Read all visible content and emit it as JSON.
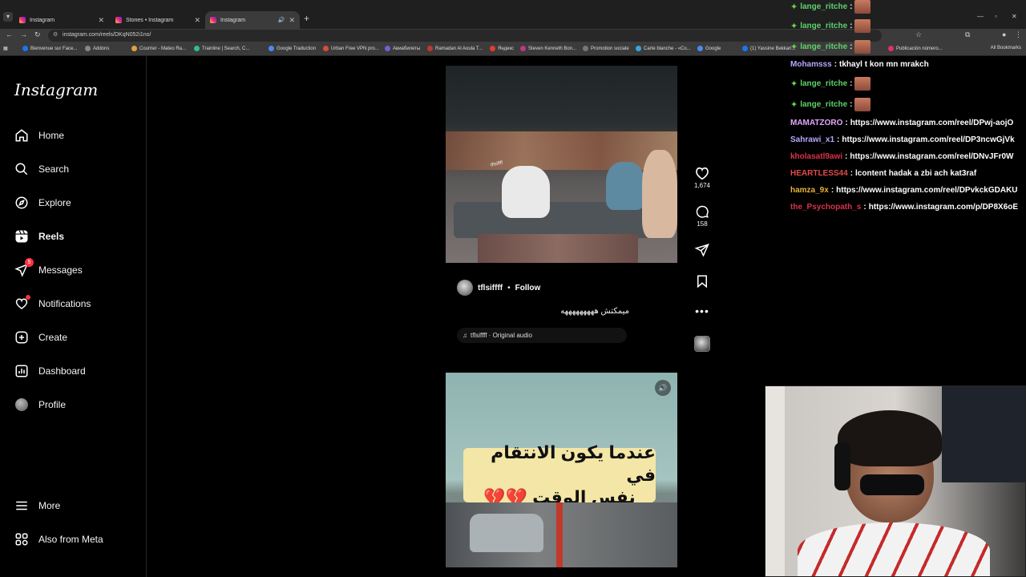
{
  "browser": {
    "tabs": [
      {
        "title": "Instagram",
        "active": false
      },
      {
        "title": "Stories • Instagram",
        "active": false
      },
      {
        "title": "Instagram",
        "active": true
      }
    ],
    "url": "instagram.com/reels/DKqN052i1no/",
    "bookmarks": [
      {
        "label": "Bienvenue sur Face...",
        "color": "#1877f2"
      },
      {
        "label": "Addons",
        "color": "#888888"
      },
      {
        "label": "Courrier - Mateo Ra...",
        "color": "#e0a33a"
      },
      {
        "label": "Trainline | Search, C...",
        "color": "#2ec08a"
      },
      {
        "label": "Google Traduction",
        "color": "#4a8af4"
      },
      {
        "label": "Urban Free VPN pro...",
        "color": "#d94b3a"
      },
      {
        "label": "Авиабилеты",
        "color": "#7a5cd6"
      },
      {
        "label": "Ramadan Al Aoula T...",
        "color": "#c0392b"
      },
      {
        "label": "Яндекс",
        "color": "#e63b2e"
      },
      {
        "label": "Steven Kenneth Bon...",
        "color": "#c13584"
      },
      {
        "label": "Promotion sociale",
        "color": "#777777"
      },
      {
        "label": "Carte blanche - «Co...",
        "color": "#3aa6d9"
      },
      {
        "label": "Google",
        "color": "#4a8af4"
      },
      {
        "label": "(1) Yassine Bekkari...",
        "color": "#1877f2"
      },
      {
        "label": "Publicación número...",
        "color": "#e1306c"
      }
    ],
    "all_bookmarks": "All Bookmarks"
  },
  "sidebar": {
    "logo": "Instagram",
    "items": [
      {
        "label": "Home",
        "icon": "home-icon"
      },
      {
        "label": "Search",
        "icon": "search-icon"
      },
      {
        "label": "Explore",
        "icon": "compass-icon"
      },
      {
        "label": "Reels",
        "icon": "reels-icon"
      },
      {
        "label": "Messages",
        "icon": "messenger-icon",
        "badge": "5"
      },
      {
        "label": "Notifications",
        "icon": "heart-icon"
      },
      {
        "label": "Create",
        "icon": "plus-square-icon"
      },
      {
        "label": "Dashboard",
        "icon": "chart-icon"
      },
      {
        "label": "Profile",
        "icon": "avatar-icon"
      },
      {
        "label": "More",
        "icon": "hamburger-icon"
      },
      {
        "label": "Also from Meta",
        "icon": "meta-apps-icon"
      }
    ]
  },
  "reel": {
    "video_overlay_text": "tflsiffff",
    "likes": "1,674",
    "comments": "158",
    "author": "tflsiffff",
    "dot": "•",
    "follow": "Follow",
    "caption": "ميمكتش هههههههههه",
    "audio": "tflsiffff · Original audio"
  },
  "reel2": {
    "overlay_line1": "عندما يكون الانتقام في",
    "overlay_line2": "نفس الوقت 💔💔"
  },
  "chat": [
    {
      "user": "lange_ritche",
      "color": "#5fd26b",
      "emote": true,
      "msg": ""
    },
    {
      "user": "lange_ritche",
      "color": "#5fd26b",
      "emote": true,
      "msg": ""
    },
    {
      "user": "lange_ritche",
      "color": "#5fd26b",
      "emote": true,
      "msg": ""
    },
    {
      "user": "Mohamsss",
      "color": "#b9a6ff",
      "emote": false,
      "msg": "tkhayl t kon mn mrakch"
    },
    {
      "user": "lange_ritche",
      "color": "#5fd26b",
      "emote": true,
      "msg": ""
    },
    {
      "user": "lange_ritche",
      "color": "#5fd26b",
      "emote": true,
      "msg": ""
    },
    {
      "user": "MAMATZORO",
      "color": "#e3a6ff",
      "emote": false,
      "msg": "https://www.instagram.com/reel/DPwj-aojO"
    },
    {
      "user": "Sahrawi_x1",
      "color": "#b9a6ff",
      "emote": false,
      "msg": "https://www.instagram.com/reel/DP3ncwGjVk"
    },
    {
      "user": "kholasatl9awi",
      "color": "#d9334a",
      "emote": false,
      "msg": "https://www.instagram.com/reel/DNvJFr0W"
    },
    {
      "user": "HEARTLESS44",
      "color": "#e34a4a",
      "emote": false,
      "msg": "lcontent hadak a zbi ach kat3raf"
    },
    {
      "user": "hamza_9x",
      "color": "#e6b33a",
      "emote": false,
      "msg": "https://www.instagram.com/reel/DPvkckGDAKU"
    },
    {
      "user": "the_Psychopath_s",
      "color": "#d9334a",
      "emote": false,
      "msg": "https://www.instagram.com/p/DP8X6oE"
    }
  ]
}
